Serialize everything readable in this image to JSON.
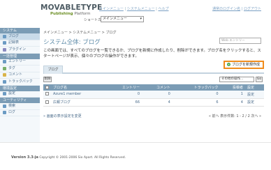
{
  "header": {
    "logo": "MOVABLETYPE",
    "logo_sub_brand": "Publishing",
    "logo_sub_rest": " Platform",
    "nav": [
      "メインメニュー",
      "システムメニュー",
      "ヘルプ"
    ],
    "user_links": [
      "通常のログイン名",
      "ログアウト"
    ],
    "shortcut_label": "ショートカット",
    "shortcut_value": "メインメニュー"
  },
  "sidebar": {
    "sections": [
      {
        "heading": "システム",
        "items": [
          "ブログ",
          "記録表",
          "プラグイン"
        ]
      },
      {
        "heading": "一括管理",
        "items": [
          "エントリー",
          "タグ",
          "コメント",
          "トラックバック"
        ]
      },
      {
        "heading": "環境設定",
        "items": [
          "設定"
        ]
      },
      {
        "heading": "ユーティリティ",
        "items": [
          "検索",
          "ログ"
        ]
      }
    ]
  },
  "main": {
    "breadcrumb": "メインメニュー > システムメニュー > ブログ",
    "title": "システム全体: ブログ",
    "search_placeholder": "Web エントリー",
    "description": "この画面では、すべてのブログを一覧できるか、ブログを新規に作成したり、削除ができます。ブログ名をクリックすると、スタートページが表示、個々のブログの操作ができます。",
    "tab": "ブログ",
    "new_blog": "ブログを新規作成",
    "delete_button": "削除",
    "action_select": "その他の操作...",
    "go_button": "Go",
    "table": {
      "headers": [
        "ブログ名",
        "エントリー",
        "コメント",
        "トラックバック",
        "投稿者",
        "設定"
      ],
      "rows": [
        {
          "name": "Azure1 member",
          "entries": "0",
          "comments": "0",
          "trackbacks": "0",
          "authors": "1",
          "setting": "設定"
        },
        {
          "name": "広報ブログ",
          "entries": "66",
          "comments": "4",
          "trackbacks": "6",
          "authors": "4",
          "setting": "設定"
        }
      ]
    },
    "pager_left": "» 画面の表示設定を変更",
    "pager_right": "« 前へ  表示件数: 1 - 2 / 2  次へ »"
  },
  "footer": {
    "version": "Version 3.3-ja",
    "copyright": " Copyright © 2001-2006 Six Apart. All Rights Reserved."
  },
  "colors": {
    "accent": "#7b9cb5",
    "highlight": "#f08c1c",
    "link": "#4a6b8a"
  }
}
